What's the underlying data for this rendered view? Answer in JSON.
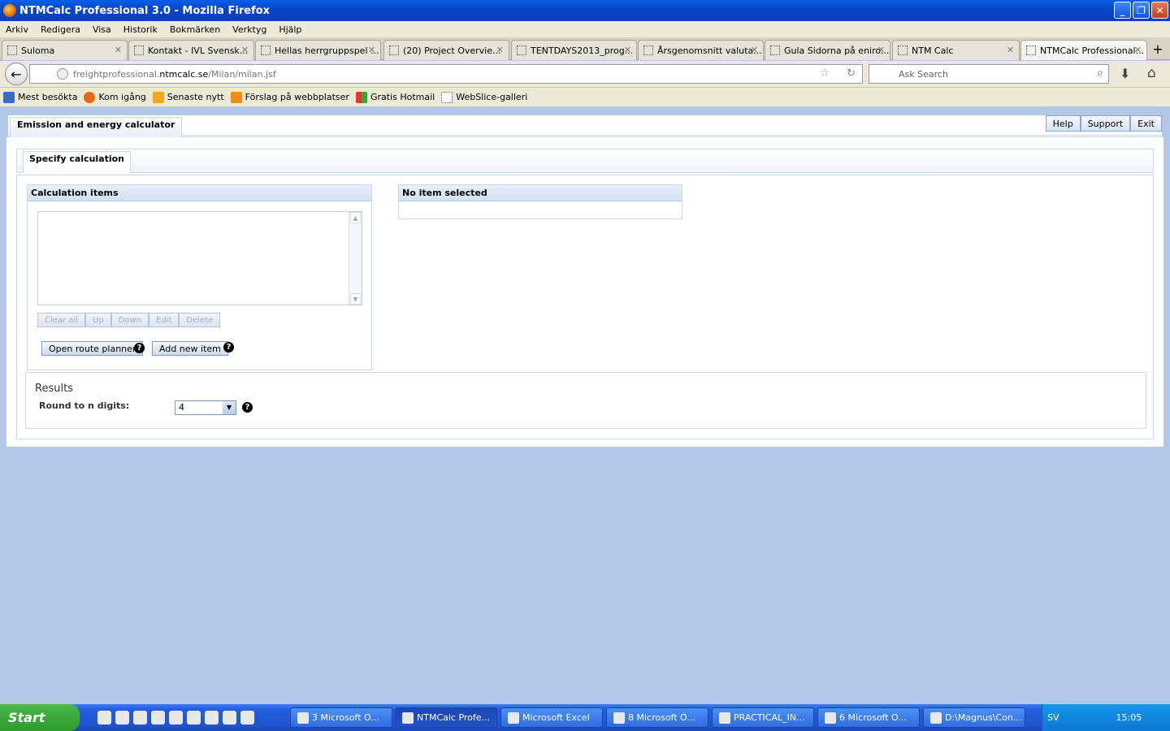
{
  "window": {
    "title": "NTMCalc Professional 3.0 - Mozilla Firefox"
  },
  "menu": [
    "Arkiv",
    "Redigera",
    "Visa",
    "Historik",
    "Bokmärken",
    "Verktyg",
    "Hjälp"
  ],
  "tabs": [
    {
      "label": "Suloma"
    },
    {
      "label": "Kontakt - IVL Svensk..."
    },
    {
      "label": "Hellas herrgruppspel ..."
    },
    {
      "label": "(20) Project Overvie..."
    },
    {
      "label": "TENTDAYS2013_prog..."
    },
    {
      "label": "Årsgenomsnitt valuta..."
    },
    {
      "label": "Gula Sidorna på eniro..."
    },
    {
      "label": "NTM Calc"
    },
    {
      "label": "NTMCalc Professional..."
    }
  ],
  "url": {
    "prefix": "freightprofessional.",
    "domain": "ntmcalc.se",
    "path": "/Milan/milan.jsf"
  },
  "search": {
    "placeholder": "Ask Search"
  },
  "bookmarks": [
    "Mest besökta",
    "Kom igång",
    "Senaste nytt",
    "Förslag på webbplatser",
    "Gratis Hotmail",
    "WebSlice-galleri"
  ],
  "app": {
    "title": "Emission and energy calculator",
    "top_buttons": {
      "help": "Help",
      "support": "Support",
      "exit": "Exit"
    },
    "subtab": "Specify calculation",
    "calc_items": {
      "heading": "Calculation items",
      "buttons": {
        "clear": "Clear all",
        "up": "Up",
        "down": "Down",
        "edit": "Edit",
        "delete": "Delete"
      },
      "open_route": "Open route planner",
      "add_item": "Add new item"
    },
    "no_item": "No item selected",
    "results": {
      "title": "Results",
      "round_label": "Round to n digits:",
      "digits": "4"
    }
  },
  "taskbar": {
    "start": "Start",
    "tasks": [
      {
        "label": "3 Microsoft O..."
      },
      {
        "label": "NTMCalc Profe..."
      },
      {
        "label": "Microsoft Excel"
      },
      {
        "label": "8 Microsoft O..."
      },
      {
        "label": "PRACTICAL_IN..."
      },
      {
        "label": "6 Microsoft O..."
      },
      {
        "label": "D:\\Magnus\\Con..."
      }
    ],
    "lang": "SV",
    "clock": "15:05"
  }
}
